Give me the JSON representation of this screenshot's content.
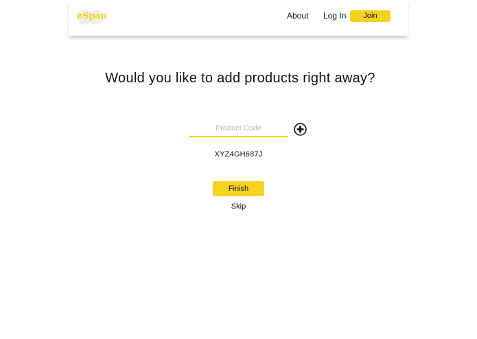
{
  "header": {
    "logo_text": "eSpan",
    "nav": {
      "about_label": "About",
      "login_label": "Log In",
      "join_label": "Join"
    }
  },
  "main": {
    "title": "Would you like to add products right away?",
    "product_code_input": {
      "placeholder": "Product Code",
      "value": ""
    },
    "add_icon": "plus-circle-icon",
    "added_codes": [
      "XYZ4GH687J"
    ],
    "finish_label": "Finish",
    "skip_label": "Skip"
  },
  "colors": {
    "accent": "#f7d21e",
    "text": "#111111",
    "placeholder": "#b8b8b8",
    "logo": "#f2d41e"
  }
}
